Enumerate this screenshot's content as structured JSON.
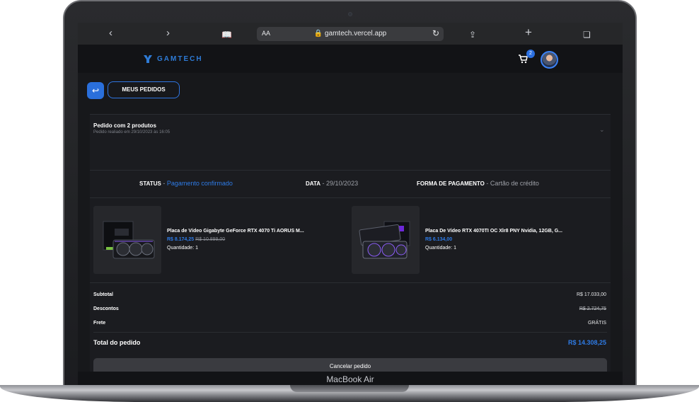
{
  "device": {
    "label": "MacBook Air"
  },
  "browser": {
    "aa_label": "AA",
    "url": "gamtech.vercel.app",
    "icons": [
      "chevron-left-icon",
      "chevron-right-icon",
      "book-icon",
      "reload-icon",
      "share-icon",
      "plus-icon",
      "tabs-icon"
    ]
  },
  "header": {
    "brand": "GAMTECH",
    "cart_count": "2",
    "brand_color": "#2e7bd6"
  },
  "page": {
    "back_icon": "return-arrow-icon",
    "title_button": "MEUS PEDIDOS"
  },
  "order": {
    "title": "Pedido com 2 produtos",
    "subtitle": "Pedido realiado em 29/10/2023 às 16:05",
    "status_label": "STATUS",
    "status_value": "Pagamento confirmado",
    "date_label": "DATA",
    "date_value": "29/10/2023",
    "payment_label": "FORMA DE PAGAMENTO",
    "payment_value": "Cartão de crédito",
    "products": [
      {
        "name": "Placa de Vídeo Gigabyte GeForce RTX 4070 Ti AORUS M...",
        "price": "R$ 8.174,25",
        "old_price": "R$ 10.899,00",
        "quantity": "Quantidade: 1"
      },
      {
        "name": "Placa De Vídeo RTX 4070TI OC Xlr8 PNY Nvidia, 12GB, G...",
        "price": "R$ 6.134,00",
        "quantity": "Quantidade: 1"
      }
    ],
    "summary": {
      "subtotal_label": "Subtotal",
      "subtotal_value": "R$ 17.033,00",
      "discount_label": "Descontos",
      "discount_value": "R$ 2.724,75",
      "shipping_label": "Frete",
      "shipping_value": "GRÁTIS",
      "total_label": "Total do pedido",
      "total_value": "R$ 14.308,25"
    },
    "cancel_button": "Cancelar pedido"
  }
}
